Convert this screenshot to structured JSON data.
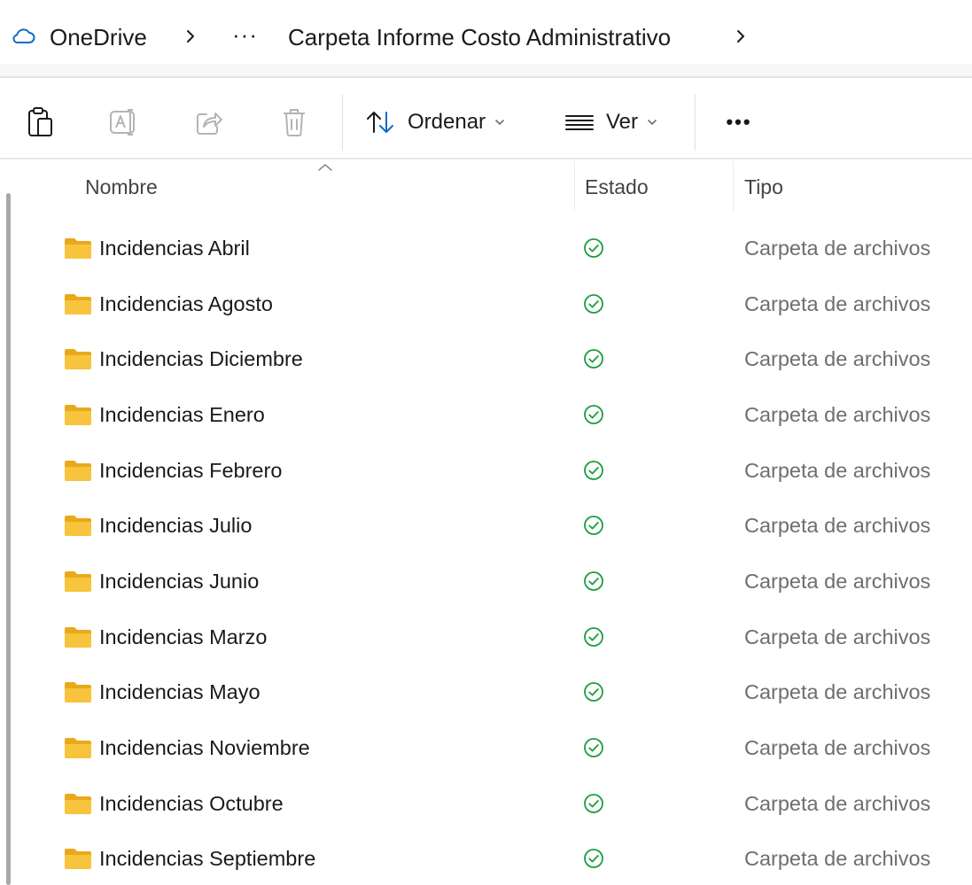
{
  "breadcrumb": {
    "root": "OneDrive",
    "root_icon": "cloud-icon",
    "overflow": "···",
    "current": "Carpeta Informe Costo Administrativo",
    "separator_icon": "chevron-right-icon"
  },
  "command_bar": {
    "icons": [
      "paste-icon",
      "rename-icon",
      "share-icon",
      "delete-icon",
      "sort-icon",
      "view-icon",
      "more-icon"
    ],
    "sort_label": "Ordenar",
    "view_label": "Ver",
    "more_label": "•••"
  },
  "list": {
    "columns": {
      "name": "Nombre",
      "status": "Estado",
      "type": "Tipo"
    },
    "rows": [
      {
        "name": "Incidencias Abril",
        "type": "Carpeta de archivos",
        "status": "sync-ok-icon"
      },
      {
        "name": "Incidencias Agosto",
        "type": "Carpeta de archivos",
        "status": "sync-ok-icon"
      },
      {
        "name": "Incidencias Diciembre",
        "type": "Carpeta de archivos",
        "status": "sync-ok-icon"
      },
      {
        "name": "Incidencias Enero",
        "type": "Carpeta de archivos",
        "status": "sync-ok-icon"
      },
      {
        "name": "Incidencias Febrero",
        "type": "Carpeta de archivos",
        "status": "sync-ok-icon"
      },
      {
        "name": "Incidencias Julio",
        "type": "Carpeta de archivos",
        "status": "sync-ok-icon"
      },
      {
        "name": "Incidencias Junio",
        "type": "Carpeta de archivos",
        "status": "sync-ok-icon"
      },
      {
        "name": "Incidencias Marzo",
        "type": "Carpeta de archivos",
        "status": "sync-ok-icon"
      },
      {
        "name": "Incidencias Mayo",
        "type": "Carpeta de archivos",
        "status": "sync-ok-icon"
      },
      {
        "name": "Incidencias Noviembre",
        "type": "Carpeta de archivos",
        "status": "sync-ok-icon"
      },
      {
        "name": "Incidencias Octubre",
        "type": "Carpeta de archivos",
        "status": "sync-ok-icon"
      },
      {
        "name": "Incidencias Septiembre",
        "type": "Carpeta de archivos",
        "status": "sync-ok-icon"
      }
    ]
  },
  "colors": {
    "folder": "#f8c43d",
    "folder_dark": "#e8a91b",
    "status_ok": "#1a9e3f",
    "icon_disabled": "#b4b4b4",
    "sort_arrow": "#0f6cbd"
  }
}
